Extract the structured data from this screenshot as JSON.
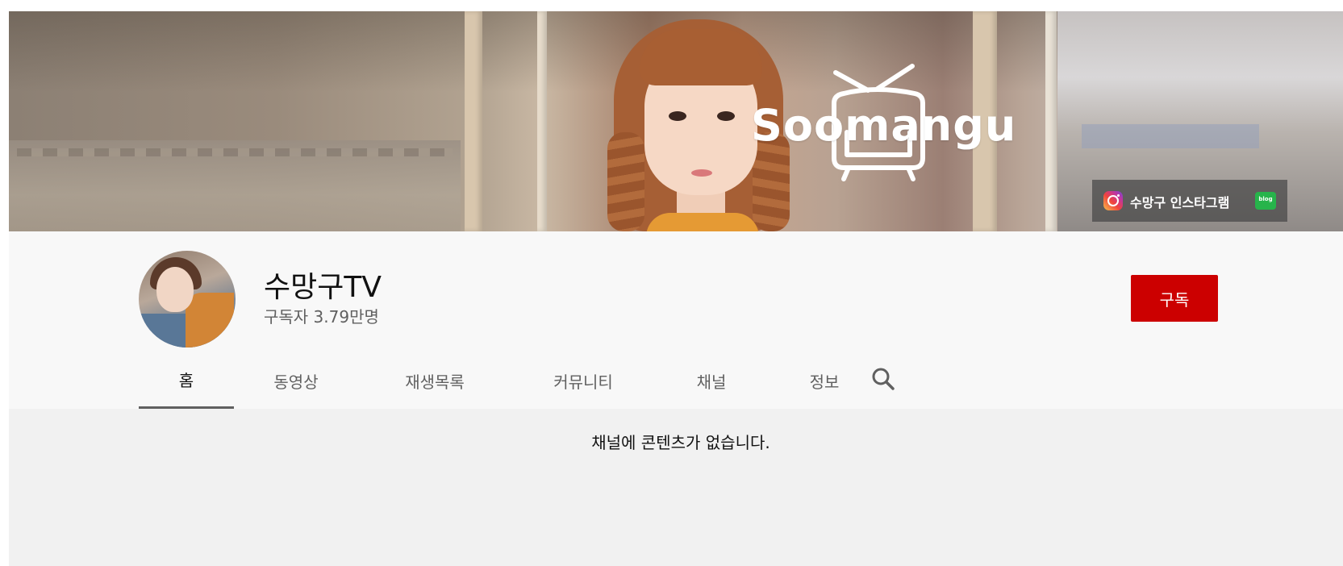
{
  "banner": {
    "logo_text": "Soomangu",
    "links": [
      {
        "icon": "instagram-icon",
        "label": "수망구 인스타그램"
      },
      {
        "icon": "blog-icon",
        "label": "blog"
      }
    ]
  },
  "channel": {
    "name": "수망구TV",
    "subscribers": "구독자 3.79만명",
    "subscribe_label": "구독"
  },
  "tabs": [
    {
      "label": "홈",
      "active": true
    },
    {
      "label": "동영상",
      "active": false
    },
    {
      "label": "재생목록",
      "active": false
    },
    {
      "label": "커뮤니티",
      "active": false
    },
    {
      "label": "채널",
      "active": false
    },
    {
      "label": "정보",
      "active": false
    }
  ],
  "search_icon": "search-icon",
  "content": {
    "empty_message": "채널에 콘텐츠가 없습니다."
  },
  "colors": {
    "subscribe_bg": "#cc0000",
    "header_bg": "#f8f8f8",
    "content_bg": "#f1f1f1"
  }
}
